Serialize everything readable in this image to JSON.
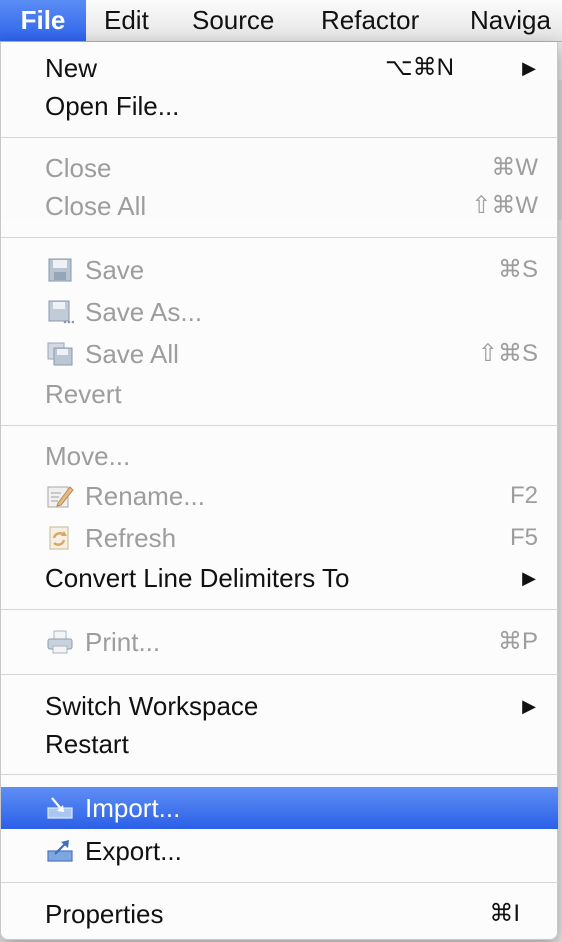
{
  "menubar": {
    "items": [
      {
        "label": "File"
      },
      {
        "label": "Edit"
      },
      {
        "label": "Source"
      },
      {
        "label": "Refactor"
      },
      {
        "label": "Naviga"
      }
    ]
  },
  "file_menu": {
    "new": {
      "label": "New",
      "shortcut": "⌥⌘N"
    },
    "open_file": {
      "label": "Open File..."
    },
    "close": {
      "label": "Close",
      "shortcut": "⌘W"
    },
    "close_all": {
      "label": "Close All",
      "shortcut": "⇧⌘W"
    },
    "save": {
      "label": "Save",
      "shortcut": "⌘S",
      "icon": "floppy-icon"
    },
    "save_as": {
      "label": "Save As...",
      "icon": "save-as-icon"
    },
    "save_all": {
      "label": "Save All",
      "shortcut": "⇧⌘S",
      "icon": "save-all-icon"
    },
    "revert": {
      "label": "Revert"
    },
    "move": {
      "label": "Move..."
    },
    "rename": {
      "label": "Rename...",
      "shortcut": "F2",
      "icon": "rename-icon"
    },
    "refresh": {
      "label": "Refresh",
      "shortcut": "F5",
      "icon": "refresh-icon"
    },
    "convert_line_delimiters": {
      "label": "Convert Line Delimiters To"
    },
    "print": {
      "label": "Print...",
      "shortcut": "⌘P",
      "icon": "printer-icon"
    },
    "switch_workspace": {
      "label": "Switch Workspace"
    },
    "restart": {
      "label": "Restart"
    },
    "import": {
      "label": "Import...",
      "icon": "import-icon"
    },
    "export": {
      "label": "Export...",
      "icon": "export-icon"
    },
    "properties": {
      "label": "Properties",
      "shortcut": "⌘I"
    }
  },
  "colors": {
    "highlight": "#2e63ea",
    "disabled_text": "#9d9d9d",
    "enabled_text": "#111111"
  }
}
